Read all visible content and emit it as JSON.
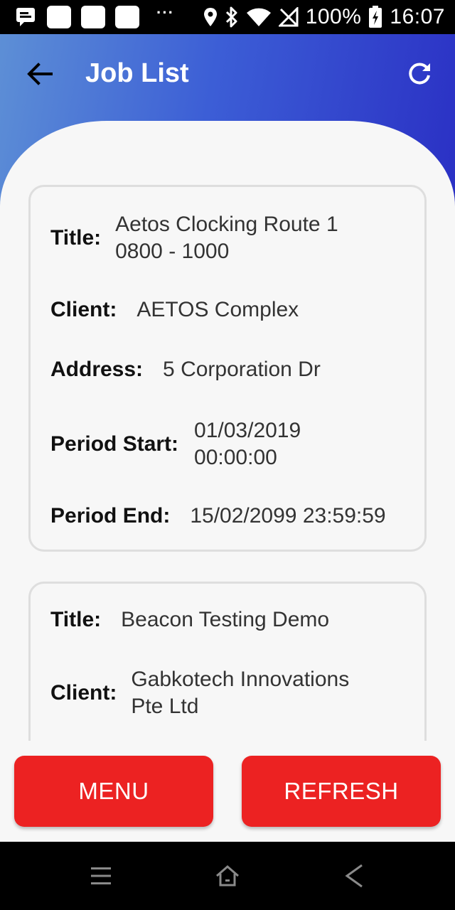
{
  "status_bar": {
    "battery": "100%",
    "time": "16:07",
    "icons": [
      "message-icon",
      "notification-icon",
      "notification-icon",
      "notification-icon",
      "more-icon",
      "location-icon",
      "bluetooth-icon",
      "wifi-icon",
      "no-sim-icon",
      "battery-charging-icon"
    ]
  },
  "header": {
    "title": "Job List",
    "back_icon": "arrow-left-icon",
    "refresh_icon": "refresh-icon",
    "gradient": [
      "#5d8fd6",
      "#2a2fc4"
    ]
  },
  "jobs": [
    {
      "title_label": "Title:",
      "title_value": "Aetos Clocking Route 1 0800 - 1000",
      "client_label": "Client:",
      "client_value": "AETOS Complex",
      "address_label": "Address:",
      "address_value": "5 Corporation Dr",
      "period_start_label": "Period Start:",
      "period_start_value": "01/03/2019 00:00:00",
      "period_end_label": "Period End:",
      "period_end_value": "15/02/2099 23:59:59"
    },
    {
      "title_label": "Title:",
      "title_value": "Beacon Testing Demo",
      "client_label": "Client:",
      "client_value": "Gabkotech Innovations Pte Ltd"
    }
  ],
  "buttons": {
    "menu": "MENU",
    "refresh": "REFRESH",
    "color": "#ec2222"
  },
  "nav_bar": {
    "icons": [
      "menu-icon",
      "home-icon",
      "back-icon"
    ]
  }
}
